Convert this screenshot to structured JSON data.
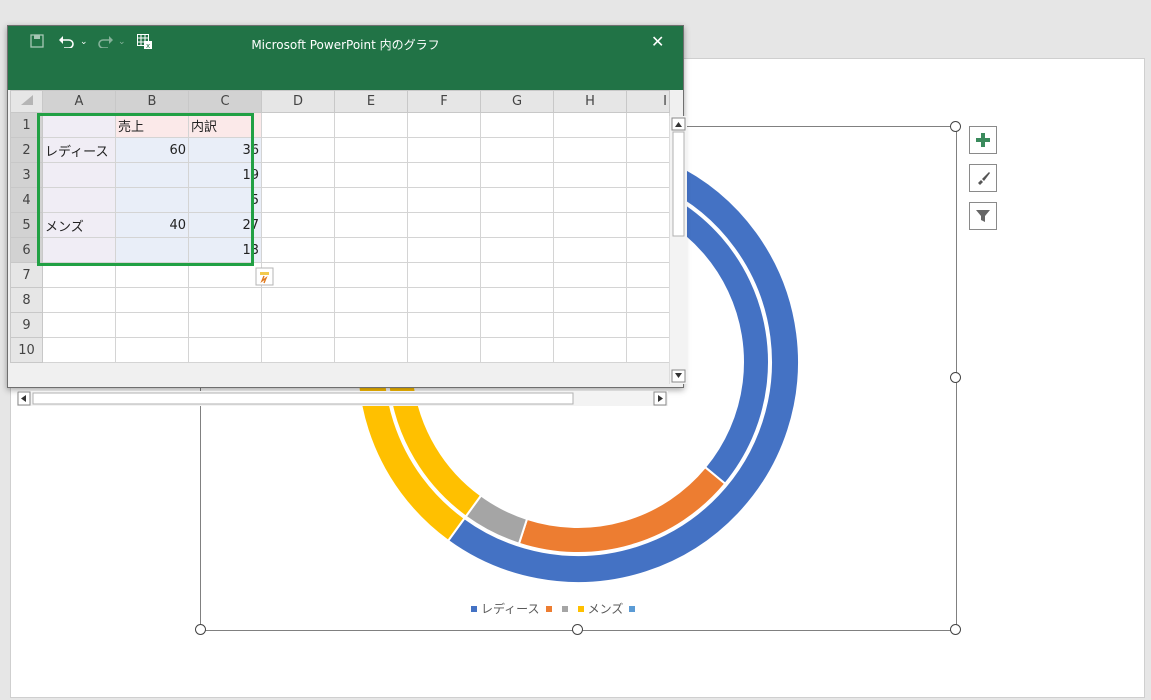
{
  "chart": {
    "legend": [
      {
        "label": "レディース",
        "color": "#4472c4"
      },
      {
        "label": "",
        "color": "#ed7d31"
      },
      {
        "label": "",
        "color": "#a5a5a5"
      },
      {
        "label": "メンズ",
        "color": "#ffc000"
      },
      {
        "label": "",
        "color": "#5b9bd5"
      }
    ],
    "side_buttons": [
      {
        "icon": "plus-icon",
        "name": "chart-elements-button"
      },
      {
        "icon": "brush-icon",
        "name": "chart-styles-button"
      },
      {
        "icon": "filter-icon",
        "name": "chart-filters-button"
      }
    ]
  },
  "chart_data": {
    "type": "pie",
    "subtype": "doughnut",
    "series": [
      {
        "name": "売上",
        "categories": [
          "レディース",
          "メンズ"
        ],
        "values": [
          60,
          40
        ],
        "colors": [
          "#4472c4",
          "#ffc000"
        ]
      },
      {
        "name": "内訳",
        "values": [
          36,
          19,
          5,
          27,
          13
        ],
        "colors": [
          "#4472c4",
          "#ed7d31",
          "#a5a5a5",
          "#ffc000",
          "#5b9bd5"
        ]
      }
    ],
    "legend_position": "bottom"
  },
  "excel": {
    "title": "Microsoft PowerPoint 内のグラフ",
    "toolbar": {
      "save": "save-icon",
      "undo": "undo-icon",
      "redo": "redo-icon",
      "edit_in_excel": "excel-icon",
      "close": "close-icon"
    },
    "columns": [
      "A",
      "B",
      "C",
      "D",
      "E",
      "F",
      "G",
      "H",
      "I"
    ],
    "rows": [
      {
        "n": "1",
        "cells": [
          "",
          "売上",
          "内訳"
        ]
      },
      {
        "n": "2",
        "cells": [
          "レディース",
          "60",
          "36"
        ]
      },
      {
        "n": "3",
        "cells": [
          "",
          "",
          "19"
        ]
      },
      {
        "n": "4",
        "cells": [
          "",
          "",
          "5"
        ]
      },
      {
        "n": "5",
        "cells": [
          "メンズ",
          "40",
          "27"
        ]
      },
      {
        "n": "6",
        "cells": [
          "",
          "",
          "13"
        ]
      },
      {
        "n": "7",
        "cells": [
          "",
          "",
          ""
        ]
      },
      {
        "n": "8",
        "cells": [
          "",
          "",
          ""
        ]
      },
      {
        "n": "9",
        "cells": [
          "",
          "",
          ""
        ]
      },
      {
        "n": "10",
        "cells": [
          "",
          "",
          ""
        ]
      }
    ]
  }
}
